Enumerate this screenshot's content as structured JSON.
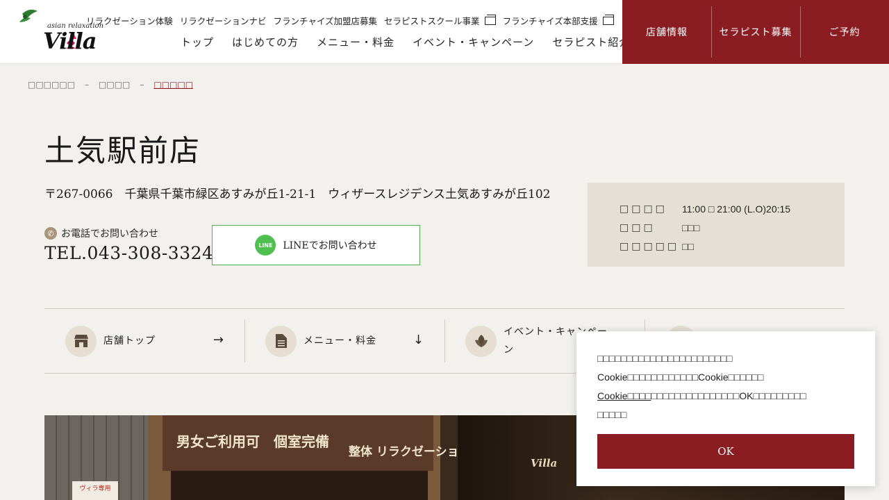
{
  "header": {
    "logo": {
      "sub": "asian relaxation",
      "main": "Villa"
    },
    "top_links": [
      {
        "label": "リラクゼーション体験",
        "external": false
      },
      {
        "label": "リラクゼーションナビ",
        "external": false
      },
      {
        "label": "フランチャイズ加盟店募集",
        "external": false
      },
      {
        "label": "セラピストスクール事業",
        "external": true
      },
      {
        "label": "フランチャイズ本部支援",
        "external": true
      }
    ],
    "main_nav": [
      "トップ",
      "はじめての方",
      "メニュー・料金",
      "イベント・キャンペーン",
      "セラピスト紹介"
    ],
    "actions": [
      "店舗情報",
      "セラピスト募集",
      "ご予約"
    ]
  },
  "breadcrumb": {
    "items": [
      "□□□□□□",
      "□□□□",
      "□□□□□"
    ]
  },
  "store": {
    "name": "土気駅前店",
    "address": "〒267-0066　千葉県千葉市緑区あすみが丘1-21-1　ウィザースレジデンス土気あすみが丘102",
    "tel_label": "お電話でお問い合わせ",
    "tel": "TEL.043-308-3324",
    "line_label": "LINEでお問い合わせ",
    "line_icon_text": "LINE"
  },
  "hours": [
    {
      "key": "□□□□",
      "value": "11:00 □ 21:00 (L.O)20:15"
    },
    {
      "key": "□□□",
      "value": "□□□"
    },
    {
      "key": "□□□□□",
      "value": "□□"
    }
  ],
  "tabs": [
    {
      "label": "店舗トップ",
      "arrow": "→",
      "icon": "shop-icon"
    },
    {
      "label": "メニュー・料金",
      "arrow": "↓",
      "icon": "document-icon"
    },
    {
      "label": "イベント・キャンペーン",
      "arrow": "→",
      "icon": "leaf-icon"
    },
    {
      "label": "",
      "arrow": "→",
      "icon": "heart-icon"
    }
  ],
  "photo": {
    "sign_text": "男女ご利用可　個室完備",
    "sign_text2": "整体 リラクゼーション",
    "sticker": "ヴィラ専用",
    "store_sign": "Villa"
  },
  "cookie": {
    "line1": "□□□□□□□□□□□□□□□□□□□□□□□",
    "line2": "Cookie□□□□□□□□□□□□Cookie□□□□□□",
    "link": "Cookie□□□□",
    "line3": "□□□□□□□□□□□□□□□OK□□□□□□□□□",
    "line4": "□□□□□",
    "ok": "OK"
  },
  "colors": {
    "brand": "#8a1c22",
    "line_green": "#4fc04f",
    "hours_bg": "#e5e0d5"
  }
}
